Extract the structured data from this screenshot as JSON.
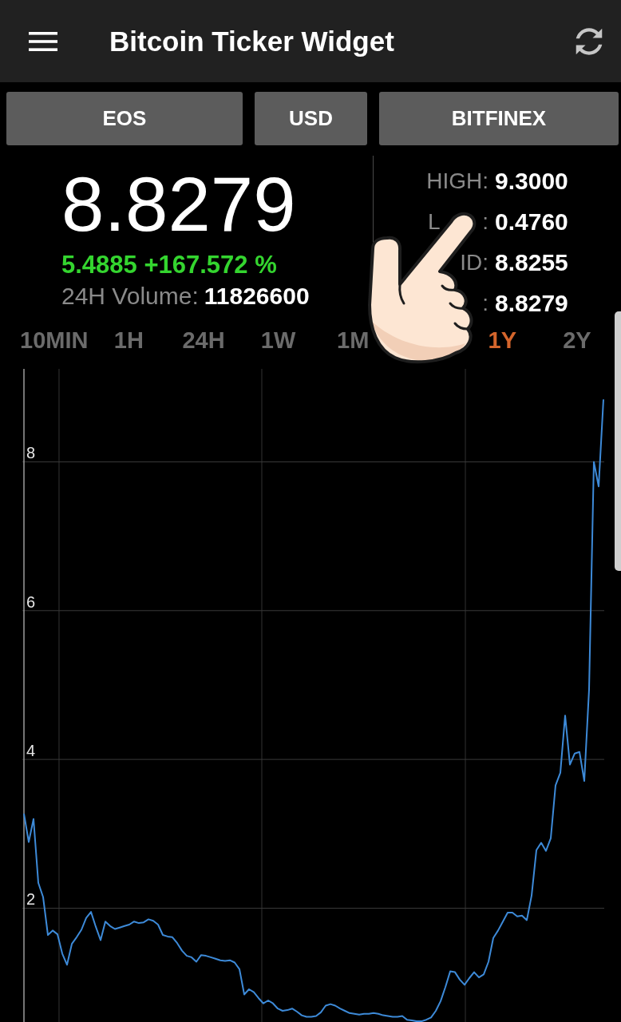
{
  "app_bar": {
    "title": "Bitcoin Ticker Widget"
  },
  "selectors": [
    {
      "kind": "coin",
      "label": "EOS"
    },
    {
      "kind": "currency",
      "label": "USD"
    },
    {
      "kind": "exchange",
      "label": "BITFINEX"
    }
  ],
  "ticker": {
    "price": "8.8279",
    "change": "5.4885 +167.572 %",
    "volume_label": "24H Volume:",
    "volume": "11826600"
  },
  "stats": [
    {
      "label": [
        "HIGH:"
      ],
      "value": "9.3000"
    },
    {
      "label": [
        "L",
        ":"
      ],
      "value": "0.4760"
    },
    {
      "label": [
        "ID:"
      ],
      "value": "8.8255"
    },
    {
      "label": [
        ":"
      ],
      "value": "8.8279"
    }
  ],
  "time_ranges": [
    {
      "label": "10MIN",
      "selected": false
    },
    {
      "label": "1H",
      "selected": false
    },
    {
      "label": "24H",
      "selected": false
    },
    {
      "label": "1W",
      "selected": false
    },
    {
      "label": "1M",
      "selected": false
    },
    {
      "label": "1Y",
      "selected": true
    },
    {
      "label": "2Y",
      "selected": false
    }
  ],
  "chart": {
    "chart_data": {
      "type": "line",
      "grid": true,
      "ylim": [
        0.47,
        9.25
      ],
      "yticks": [
        2,
        4,
        6,
        8
      ],
      "series": [
        {
          "color": "#3d8ad8",
          "values": [
            3.27,
            2.89,
            3.2,
            2.34,
            2.15,
            1.64,
            1.7,
            1.65,
            1.39,
            1.24,
            1.52,
            1.61,
            1.71,
            1.87,
            1.95,
            1.75,
            1.57,
            1.82,
            1.76,
            1.72,
            1.74,
            1.76,
            1.78,
            1.82,
            1.8,
            1.81,
            1.85,
            1.83,
            1.78,
            1.64,
            1.62,
            1.61,
            1.53,
            1.43,
            1.36,
            1.34,
            1.28,
            1.37,
            1.36,
            1.34,
            1.32,
            1.3,
            1.29,
            1.3,
            1.27,
            1.18,
            0.84,
            0.91,
            0.87,
            0.79,
            0.72,
            0.76,
            0.72,
            0.65,
            0.62,
            0.63,
            0.65,
            0.61,
            0.56,
            0.54,
            0.54,
            0.55,
            0.6,
            0.69,
            0.71,
            0.69,
            0.65,
            0.62,
            0.59,
            0.58,
            0.57,
            0.58,
            0.58,
            0.59,
            0.58,
            0.56,
            0.55,
            0.54,
            0.54,
            0.55,
            0.5,
            0.49,
            0.48,
            0.48,
            0.5,
            0.53,
            0.62,
            0.75,
            0.94,
            1.15,
            1.14,
            1.04,
            0.97,
            1.06,
            1.14,
            1.07,
            1.11,
            1.28,
            1.6,
            1.7,
            1.82,
            1.94,
            1.94,
            1.89,
            1.9,
            1.84,
            2.17,
            2.78,
            2.88,
            2.77,
            2.94,
            3.65,
            3.82,
            4.59,
            3.93,
            4.08,
            4.1,
            3.71,
            4.94,
            8.0,
            7.67,
            8.84
          ]
        }
      ]
    }
  }
}
